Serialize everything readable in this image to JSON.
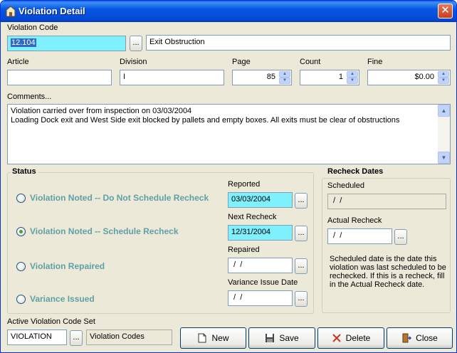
{
  "window": {
    "title": "Violation Detail",
    "close_glyph": "✕"
  },
  "violation_code": {
    "label": "Violation Code",
    "value": "12.104",
    "description": "Exit Obstruction",
    "lookup_label": "..."
  },
  "article": {
    "label": "Article",
    "value": ""
  },
  "division": {
    "label": "Division",
    "value": "I"
  },
  "page": {
    "label": "Page",
    "value": "85"
  },
  "count": {
    "label": "Count",
    "value": "1"
  },
  "fine": {
    "label": "Fine",
    "value": "$0.00"
  },
  "comments": {
    "label": "Comments...",
    "lines": [
      "Violation carried over from inspection on 03/03/2004",
      "Loading Dock exit and West Side exit blocked by pallets and empty boxes. All exits must be clear of obstructions"
    ]
  },
  "status": {
    "title": "Status",
    "options": [
      {
        "label": "Violation Noted -- Do Not Schedule Recheck",
        "selected": false
      },
      {
        "label": "Violation Noted -- Schedule Recheck",
        "selected": true
      },
      {
        "label": "Violation Repaired",
        "selected": false
      },
      {
        "label": "Variance Issued",
        "selected": false
      }
    ],
    "reported": {
      "label": "Reported",
      "value": "03/03/2004"
    },
    "next_recheck": {
      "label": "Next Recheck",
      "value": "12/31/2004"
    },
    "repaired": {
      "label": "Repaired",
      "value": " /  /"
    },
    "variance_issue_date": {
      "label": "Variance Issue Date",
      "value": " /  /"
    }
  },
  "recheck_dates": {
    "title": "Recheck Dates",
    "scheduled": {
      "label": "Scheduled",
      "value": " /  /"
    },
    "actual": {
      "label": "Actual Recheck",
      "value": " /  /"
    },
    "note": "Scheduled date is the date this violation was last scheduled to be rechecked.  If this is a recheck, fill in the Actual  Recheck date."
  },
  "code_set": {
    "label": "Active Violation Code Set",
    "value": "VIOLATION",
    "description": "Violation Codes"
  },
  "buttons": {
    "new": "New",
    "save": "Save",
    "delete": "Delete",
    "close": "Close"
  },
  "colors": {
    "accent": "#0449d6",
    "field_highlight": "#7ff0fd",
    "status_text": "#5fa0a6"
  }
}
